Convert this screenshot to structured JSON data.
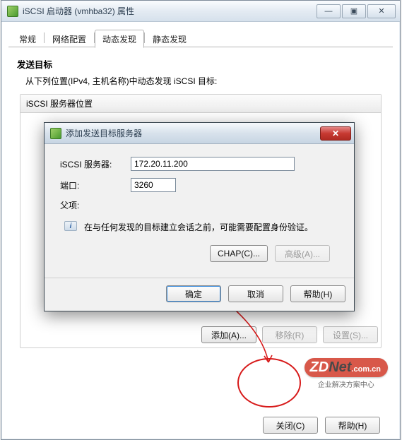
{
  "window": {
    "title": "iSCSI 启动器 (vmhba32) 属性",
    "min_glyph": "—",
    "max_glyph": "▣",
    "close_glyph": "✕"
  },
  "tabs": {
    "items": [
      {
        "label": "常规"
      },
      {
        "label": "网络配置"
      },
      {
        "label": "动态发现"
      },
      {
        "label": "静态发现"
      }
    ],
    "active_index": 2
  },
  "section": {
    "title": "发送目标",
    "description": "从下列位置(IPv4, 主机名称)中动态发现 iSCSI 目标:",
    "group_header": "iSCSI 服务器位置"
  },
  "group_buttons": {
    "add": "添加(A)...",
    "remove": "移除(R)",
    "settings": "设置(S)..."
  },
  "footer": {
    "close": "关闭(C)",
    "help": "帮助(H)"
  },
  "dialog": {
    "title": "添加发送目标服务器",
    "close_glyph": "✕",
    "labels": {
      "server": "iSCSI 服务器:",
      "port": "端口:",
      "parent": "父项:"
    },
    "values": {
      "server": "172.20.11.200",
      "port": "3260"
    },
    "note_text": "在与任何发现的目标建立会话之前，可能需要配置身份验证。",
    "buttons": {
      "chap": "CHAP(C)...",
      "advanced": "高级(A)...",
      "ok": "确定",
      "cancel": "取消",
      "help": "帮助(H)"
    }
  },
  "watermark": {
    "brand_main": "ZD",
    "brand_net": "Net",
    "brand_suffix": ".com.cn",
    "tagline": "企业解决方案中心"
  }
}
